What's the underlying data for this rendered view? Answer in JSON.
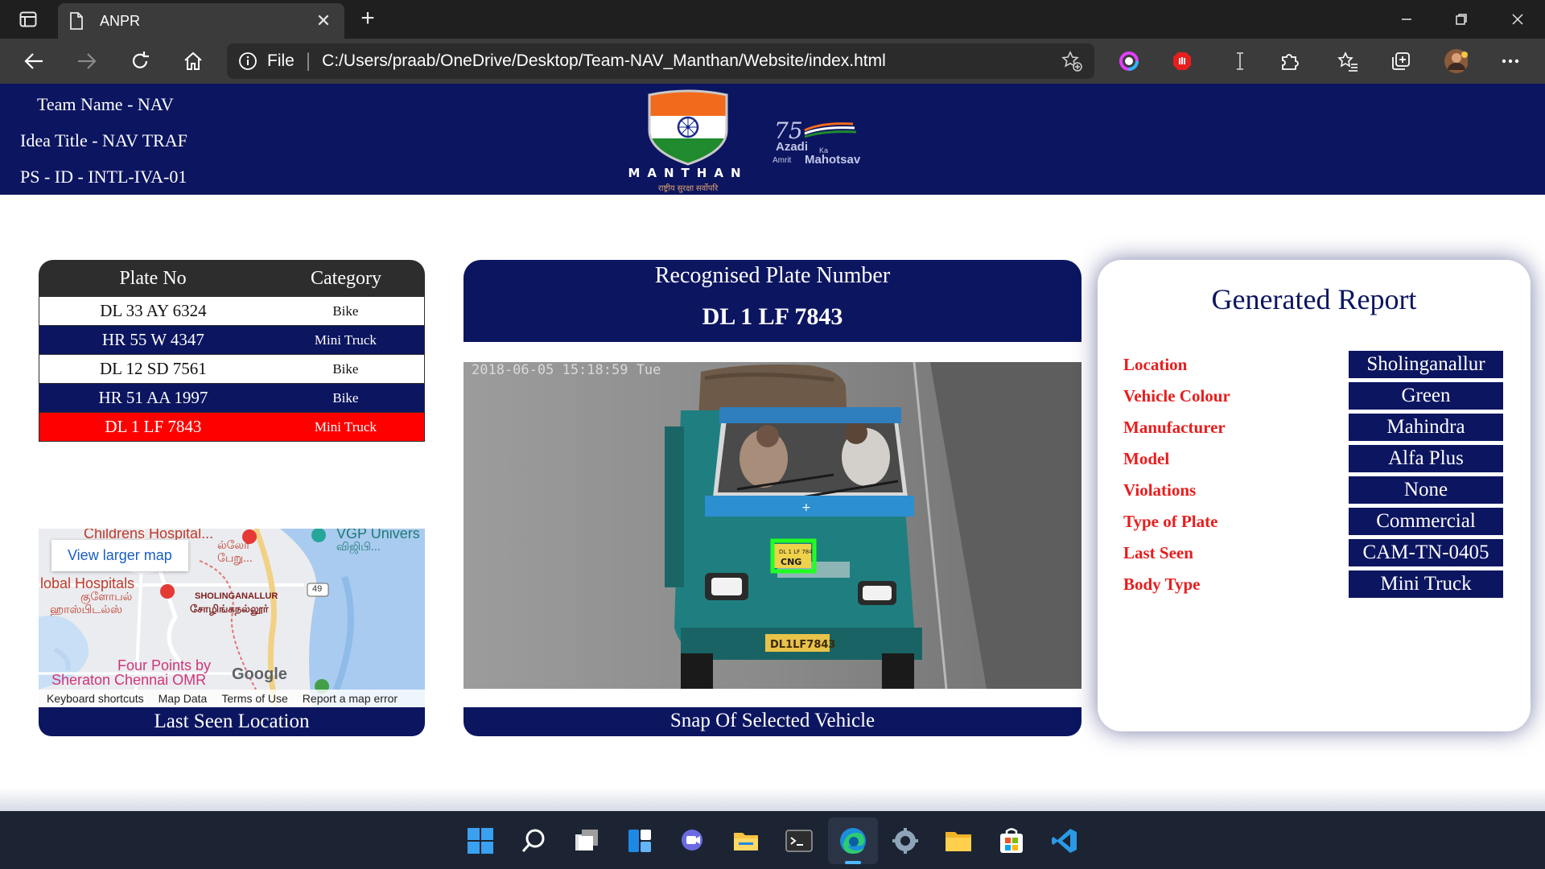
{
  "browser": {
    "tab_title": "ANPR",
    "new_tab_label": "+",
    "close_tab_label": "✕",
    "scheme_label": "File",
    "url": "C:/Users/praab/OneDrive/Desktop/Team-NAV_Manthan/Website/index.html"
  },
  "header": {
    "team_name": "Team Name - NAV",
    "idea_title": "Idea Title - NAV TRAF",
    "ps_id": "PS - ID - INTL-IVA-01",
    "logo_word": "MANTHAN",
    "logo_subtext": "राष्ट्रीय सुरक्षा सर्वोपरि",
    "azadi_number": "75",
    "azadi_line1": "Azadi",
    "azadi_ka": "Ka",
    "azadi_line2": "Amrit",
    "azadi_line3": "Mahotsav"
  },
  "plates": {
    "col_plate": "Plate No",
    "col_category": "Category",
    "rows": [
      {
        "plate": "DL 33 AY 6324",
        "category": "Bike"
      },
      {
        "plate": "HR 55 W 4347",
        "category": "Mini Truck"
      },
      {
        "plate": "DL 12 SD 7561",
        "category": "Bike"
      },
      {
        "plate": "HR 51 AA 1997",
        "category": "Bike"
      },
      {
        "plate": "DL 1 LF 7843",
        "category": "Mini Truck"
      }
    ]
  },
  "map": {
    "larger_map_link": "View larger map",
    "labels": {
      "childrens": "Childrens Hospital...",
      "childrens_tamil": "ல்லோ",
      "childrens_tamil2": "பேறு...",
      "vgp": "VGP Univers",
      "vgp_tamil": "விஜிபி...",
      "global": "lobal Hospitals",
      "global_tamil": "குளோபல்",
      "global_tamil2": "ஹாஸ்பிடல்ஸ்",
      "sholinganallur": "SHOLINGANALLUR",
      "sholinganallur_tamil": "சோழிங்கநல்லூர்",
      "road_49": "49",
      "four_points": "Four Points by",
      "sheraton": "Sheraton Chennai OMR",
      "google": "Google"
    },
    "footer": [
      "Keyboard shortcuts",
      "Map Data",
      "Terms of Use",
      "Report a map error"
    ],
    "caption": "Last Seen Location"
  },
  "recognition": {
    "title": "Recognised Plate Number",
    "plate": "DL 1 LF 7843"
  },
  "snapshot": {
    "timestamp": "2018-06-05 15:18:59 Tue",
    "plate_on_truck": "DL1LF7843",
    "detected_plate_text": "DL 1 LF 7843",
    "cng_label": "CNG",
    "caption": "Snap Of Selected Vehicle"
  },
  "report": {
    "title": "Generated Report",
    "fields": [
      {
        "label": "Location",
        "value": "Sholinganallur"
      },
      {
        "label": "Vehicle Colour",
        "value": "Green"
      },
      {
        "label": "Manufacturer",
        "value": "Mahindra"
      },
      {
        "label": "Model",
        "value": "Alfa Plus"
      },
      {
        "label": "Violations",
        "value": "None"
      },
      {
        "label": "Type of Plate",
        "value": "Commercial"
      },
      {
        "label": "Last Seen",
        "value": "CAM-TN-0405"
      },
      {
        "label": "Body Type",
        "value": "Mini Truck"
      }
    ]
  },
  "colors": {
    "navy": "#0c1560",
    "selected_row": "#ff0000",
    "report_label": "#e81d1d",
    "detection_box": "#22ff22"
  },
  "icons": {
    "taskbar": [
      "windows-start-icon",
      "search-icon",
      "task-view-icon",
      "widgets-icon",
      "chat-icon",
      "file-explorer-icon",
      "terminal-icon",
      "edge-icon",
      "settings-icon",
      "folder-icon",
      "store-icon",
      "vscode-icon"
    ]
  }
}
